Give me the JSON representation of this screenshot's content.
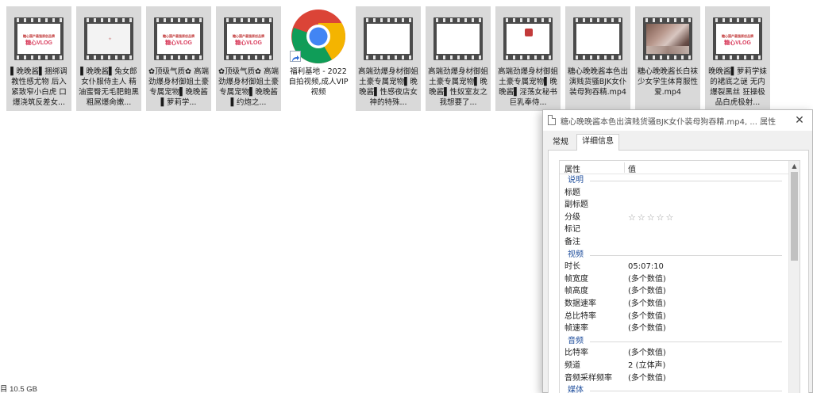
{
  "files": [
    {
      "name": "▌晚晚酱▌捆绑调教性感尤物 后入紧致窄小白虎 口爆浇筑反差女...",
      "thumb": "vlog",
      "cover_top": "糖心国产最强原创品牌",
      "cover_logo": "糖心VLOG"
    },
    {
      "name": "▌晚晚酱▌兔女郎女仆服侍主人 精油蜜臀无毛肥鲍黑粗屌爆肏嫩...",
      "thumb": "dim"
    },
    {
      "name": "✿顶级气质✿ 高端劲爆身材御姐土豪专属宠物▌晚晚酱▌萝莉学...",
      "thumb": "vlog",
      "cover_top": "糖心国产最强原创品牌",
      "cover_logo": "糖心VLOG"
    },
    {
      "name": "✿顶级气质✿ 高端劲爆身材御姐土豪专属宠物▌晚晚酱▌约炮之...",
      "thumb": "vlog",
      "cover_top": "糖心国产最强原创品牌",
      "cover_logo": "糖心VLOG"
    },
    {
      "name": "福利基地 - 2022自拍视频,成人VIP视频",
      "thumb": "chrome"
    },
    {
      "name": "高端劲爆身材御姐土豪专属宠物▌晚晚酱▌性感夜店女神的特殊...",
      "thumb": "blank"
    },
    {
      "name": "高端劲爆身材御姐土豪专属宠物▌晚晚酱▌性奴室友之我想要了...",
      "thumb": "blank"
    },
    {
      "name": "高端劲爆身材御姐土豪专属宠物▌晚晚酱▌淫荡女秘书巨乳奉侍...",
      "thumb": "cover"
    },
    {
      "name": "糖心晚晚酱本色出演贱货骚BJK女仆装母狗吞精.mp4",
      "thumb": "blank"
    },
    {
      "name": "糖心晚晚酱长白袜少女学生体育服性爱.mp4",
      "thumb": "photo"
    },
    {
      "name": "晚晚酱▌萝莉学妹的裙底之谜 无内爆裂黑丝 狂操极品白虎极射...",
      "thumb": "vlog",
      "cover_top": "糖心国产最强原创品牌",
      "cover_logo": "糖心VLOG"
    }
  ],
  "status_bar": {
    "text": "目  10.5 GB"
  },
  "dialog": {
    "title": "糖心晚晚酱本色出演贱货骚BJK女仆装母狗吞精.mp4, ... 属性",
    "tabs": [
      {
        "label": "常规",
        "active": false
      },
      {
        "label": "详细信息",
        "active": true
      }
    ],
    "columns": {
      "property": "属性",
      "value": "值"
    },
    "rows": [
      {
        "type": "section",
        "label": "说明"
      },
      {
        "type": "item",
        "label": "标题",
        "value": ""
      },
      {
        "type": "item",
        "label": "副标题",
        "value": ""
      },
      {
        "type": "rating",
        "label": "分级",
        "stars": 5
      },
      {
        "type": "item",
        "label": "标记",
        "value": ""
      },
      {
        "type": "item",
        "label": "备注",
        "value": ""
      },
      {
        "type": "section",
        "label": "视频"
      },
      {
        "type": "item",
        "label": "时长",
        "value": "05:07:10"
      },
      {
        "type": "item",
        "label": "帧宽度",
        "value": "(多个数值)"
      },
      {
        "type": "item",
        "label": "帧高度",
        "value": "(多个数值)"
      },
      {
        "type": "item",
        "label": "数据速率",
        "value": "(多个数值)"
      },
      {
        "type": "item",
        "label": "总比特率",
        "value": "(多个数值)"
      },
      {
        "type": "item",
        "label": "帧速率",
        "value": "(多个数值)"
      },
      {
        "type": "section",
        "label": "音频"
      },
      {
        "type": "item",
        "label": "比特率",
        "value": "(多个数值)"
      },
      {
        "type": "item",
        "label": "频道",
        "value": "2 (立体声)"
      },
      {
        "type": "item",
        "label": "音频采样频率",
        "value": "(多个数值)"
      },
      {
        "type": "section",
        "label": "媒体"
      }
    ]
  },
  "colors": {
    "section": "#1f4e9c",
    "tile_bg": "#d9d9d9",
    "dialog_bg": "#f0f0f0"
  }
}
